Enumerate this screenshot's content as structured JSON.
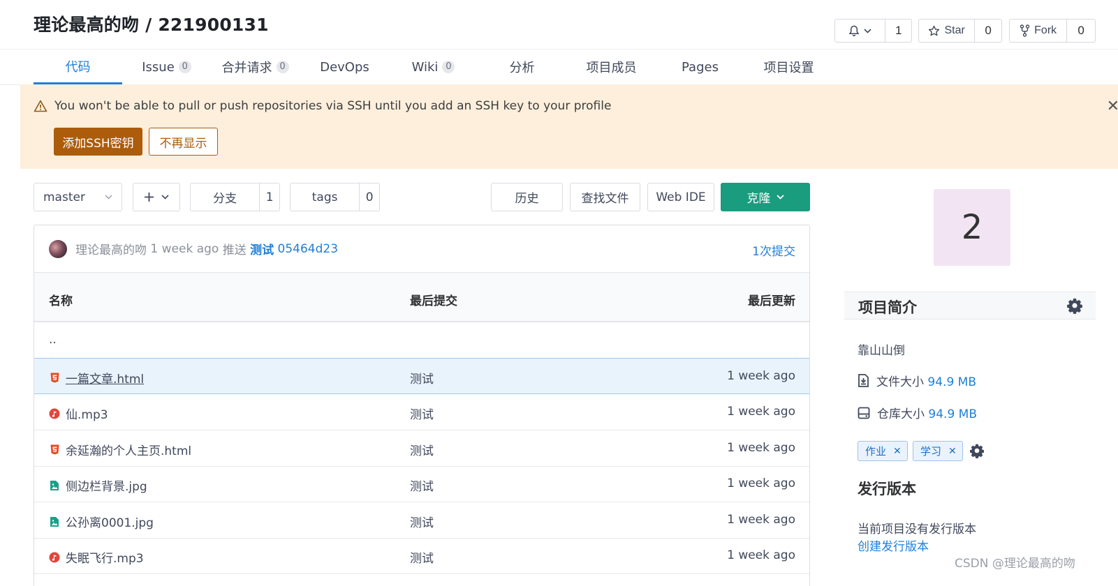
{
  "header": {
    "title": "理论最高的吻 / 221900131",
    "watch_count": "1",
    "star_label": "Star",
    "star_count": "0",
    "fork_label": "Fork",
    "fork_count": "0"
  },
  "tabs": [
    {
      "label": "代码",
      "badge": null,
      "active": true
    },
    {
      "label": "Issue",
      "badge": "0"
    },
    {
      "label": "合并请求",
      "badge": "0"
    },
    {
      "label": "DevOps",
      "badge": null
    },
    {
      "label": "Wiki",
      "badge": "0"
    },
    {
      "label": "分析",
      "badge": null
    },
    {
      "label": "项目成员",
      "badge": null
    },
    {
      "label": "Pages",
      "badge": null
    },
    {
      "label": "项目设置",
      "badge": null
    }
  ],
  "alert": {
    "message": "You won't be able to pull or push repositories via SSH until you add an SSH key to your profile",
    "add_ssh": "添加SSH密钥",
    "dismiss": "不再显示"
  },
  "toolbar": {
    "branch": "master",
    "branches_label": "分支",
    "branches_count": "1",
    "tags_label": "tags",
    "tags_count": "0",
    "history": "历史",
    "find_file": "查找文件",
    "web_ide": "Web IDE",
    "clone": "克隆"
  },
  "commit": {
    "author": "理论最高的吻",
    "time": "1 week ago",
    "action": "推送",
    "message": "测试",
    "sha": "05464d23",
    "count": "1次提交"
  },
  "table": {
    "headers": {
      "name": "名称",
      "last_commit": "最后提交",
      "last_update": "最后更新"
    },
    "parent": "..",
    "rows": [
      {
        "name": "一篇文章.html",
        "icon": "html5-icon",
        "commit": "测试",
        "updated": "1 week ago"
      },
      {
        "name": "仙.mp3",
        "icon": "audio-icon",
        "commit": "测试",
        "updated": "1 week ago"
      },
      {
        "name": "余延瀚的个人主页.html",
        "icon": "html5-icon",
        "commit": "测试",
        "updated": "1 week ago"
      },
      {
        "name": "侧边栏背景.jpg",
        "icon": "image-icon",
        "commit": "测试",
        "updated": "1 week ago"
      },
      {
        "name": "公孙离0001.jpg",
        "icon": "image-icon",
        "commit": "测试",
        "updated": "1 week ago"
      },
      {
        "name": "失眠飞行.mp3",
        "icon": "audio-icon",
        "commit": "测试",
        "updated": "1 week ago"
      }
    ]
  },
  "sidebar": {
    "avatar_text": "2",
    "intro_title": "项目简介",
    "description": "靠山山倒",
    "file_size_label": "文件大小",
    "file_size": "94.9 MB",
    "repo_size_label": "仓库大小",
    "repo_size": "94.9 MB",
    "tags": [
      "作业",
      "学习"
    ],
    "releases_title": "发行版本",
    "no_release": "当前项目没有发行版本",
    "create_release": "创建发行版本"
  },
  "watermark": "CSDN @理论最高的吻",
  "colors": {
    "accent": "#1f7fd8",
    "clone_green": "#1a9c7e",
    "alert_bg": "#fdefdc",
    "ssh_button": "#ac5c0b"
  }
}
